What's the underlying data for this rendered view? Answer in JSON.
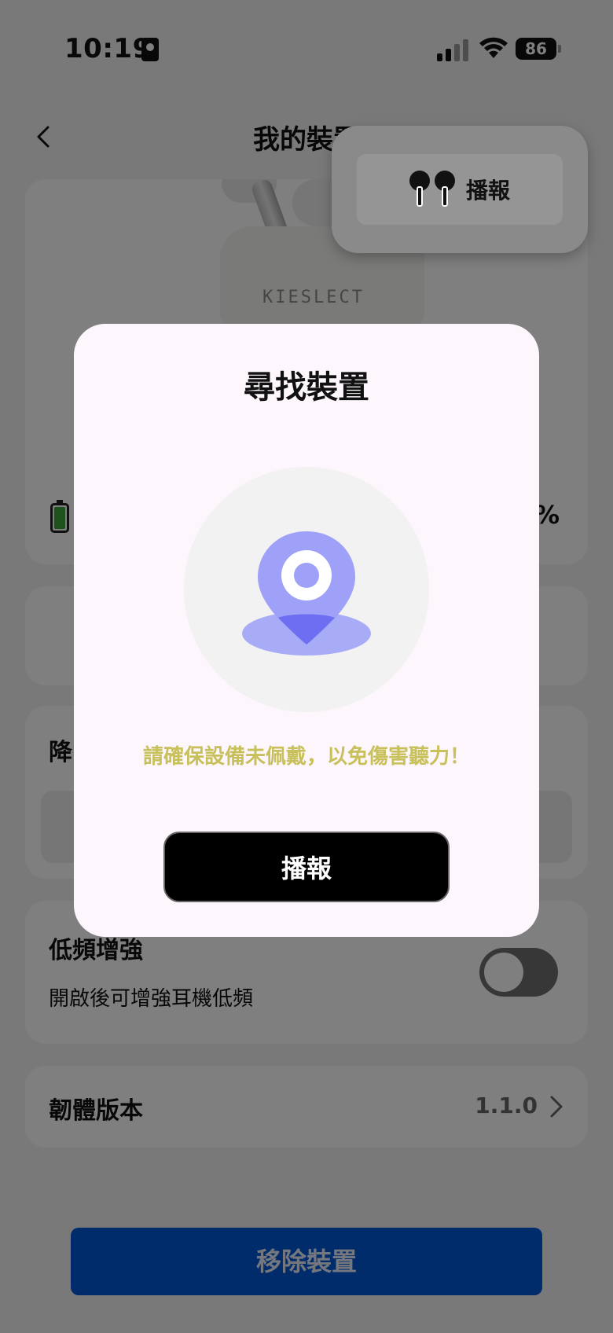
{
  "status_bar": {
    "time": "10:19",
    "battery": "86"
  },
  "header": {
    "title": "我的裝置"
  },
  "device": {
    "case_brand": "KIESLECT",
    "battery_pct": "%"
  },
  "anc": {
    "label": "降"
  },
  "bass": {
    "title": "低頻增強",
    "description": "開啟後可增強耳機低頻",
    "enabled": false
  },
  "firmware": {
    "label": "韌體版本",
    "version": "1.1.0"
  },
  "remove_button": "移除裝置",
  "popover": {
    "item_label": "播報"
  },
  "modal": {
    "title": "尋找裝置",
    "message": "請確保設備未佩戴，以免傷害聽力！",
    "button": "播報"
  },
  "colors": {
    "accent": "#6a6cf5",
    "warning_text": "#c8c05a",
    "primary_button": "#0059d8"
  }
}
